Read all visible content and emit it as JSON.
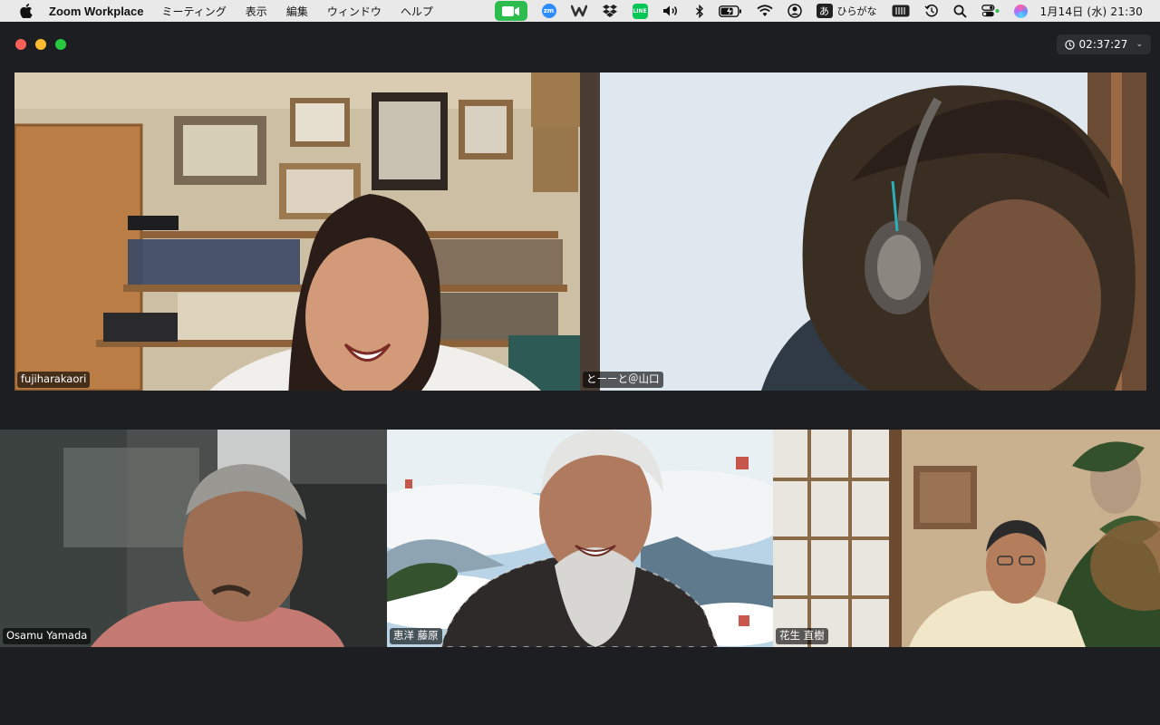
{
  "menubar": {
    "app_name": "Zoom Workplace",
    "menus": [
      "ミーティング",
      "表示",
      "編集",
      "ウィンドウ",
      "ヘルプ"
    ],
    "ime_badge": "あ",
    "ime_label": "ひらがな",
    "datetime": "1月14日 (水)  21:30",
    "zoom_tray_label": "zm",
    "line_tray_label": "LINE",
    "tray_icons": [
      "zoom-video-icon",
      "zoom-icon",
      "webex-icon",
      "dropbox-icon",
      "line-icon",
      "volume-icon",
      "bluetooth-icon",
      "battery-icon",
      "wifi-icon",
      "user-icon",
      "input-method-icon",
      "keyboard-icon",
      "time-machine-icon",
      "spotlight-icon",
      "control-center-icon",
      "siri-icon"
    ]
  },
  "meeting": {
    "elapsed_time": "02:37:27"
  },
  "participants": [
    {
      "name": "fujiharakaori"
    },
    {
      "name": "とーーと＠山口"
    },
    {
      "name": "Osamu Yamada"
    },
    {
      "name": "恵洋 藤原"
    },
    {
      "name": "花生 直樹"
    }
  ],
  "colors": {
    "window_bg": "#1c1e21",
    "menubar_bg": "#eae9ea",
    "zoom_video_tray": "#2dbd4f",
    "zoom_blue": "#2d8cff"
  }
}
